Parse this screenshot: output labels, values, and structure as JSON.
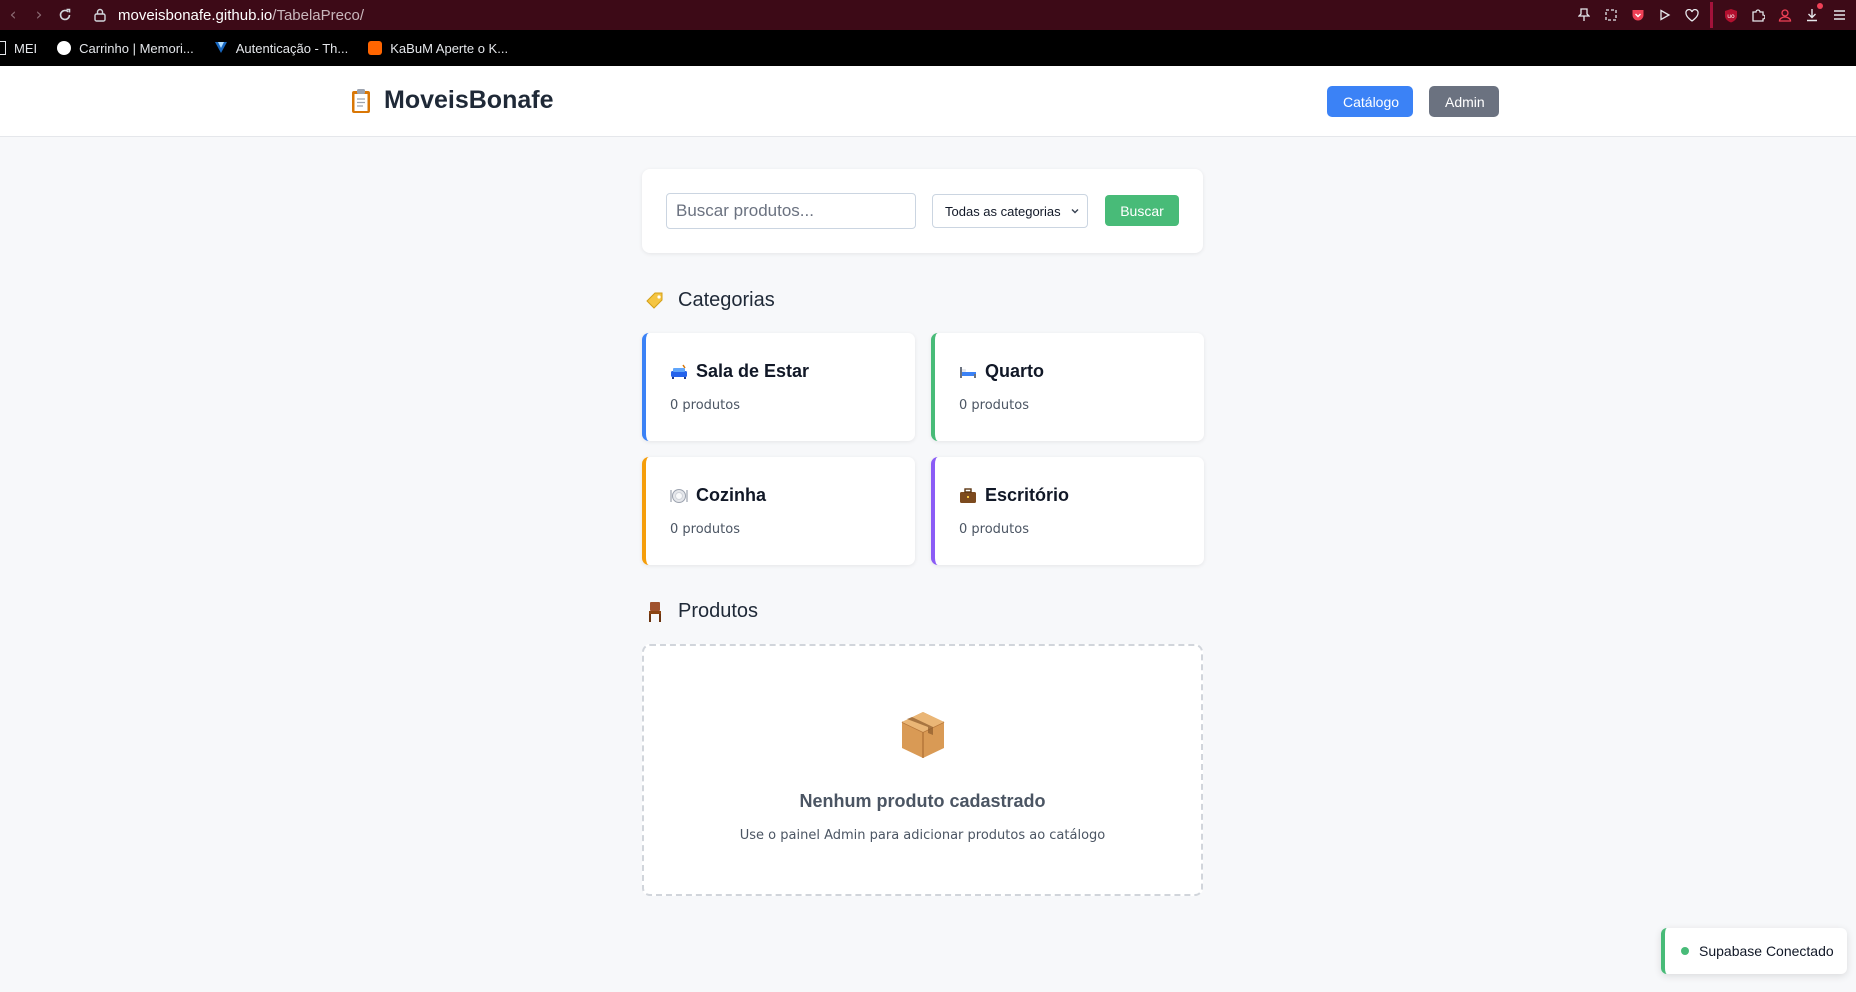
{
  "browser": {
    "url_host": "moveisbonafe.github.io",
    "url_path": "/TabelaPreco/",
    "bookmarks": [
      {
        "label": "MEI"
      },
      {
        "label": "Carrinho | Memori..."
      },
      {
        "label": "Autenticação - Th..."
      },
      {
        "label": "KaBuM Aperte o K..."
      }
    ]
  },
  "header": {
    "brand": "MoveisBonafe",
    "brand_icon": "clipboard-icon",
    "nav": {
      "catalogo": "Catálogo",
      "admin": "Admin"
    }
  },
  "search": {
    "placeholder": "Buscar produtos...",
    "category_selected": "Todas as categorias",
    "button": "Buscar"
  },
  "categories_section": {
    "title": "Categorias",
    "icon": "tag-icon",
    "items": [
      {
        "name": "Sala de Estar",
        "count": "0 produtos",
        "icon": "couch-icon",
        "color": "#3b82f6"
      },
      {
        "name": "Quarto",
        "count": "0 produtos",
        "icon": "bed-icon",
        "color": "#48bb78"
      },
      {
        "name": "Cozinha",
        "count": "0 produtos",
        "icon": "plate-icon",
        "color": "#f59e0b"
      },
      {
        "name": "Escritório",
        "count": "0 produtos",
        "icon": "briefcase-icon",
        "color": "#8b5cf6"
      }
    ]
  },
  "products_section": {
    "title": "Produtos",
    "icon": "chair-icon",
    "empty_title": "Nenhum produto cadastrado",
    "empty_subtitle": "Use o painel Admin para adicionar produtos ao catálogo"
  },
  "toast": {
    "text": "Supabase Conectado",
    "color": "#48bb78"
  }
}
